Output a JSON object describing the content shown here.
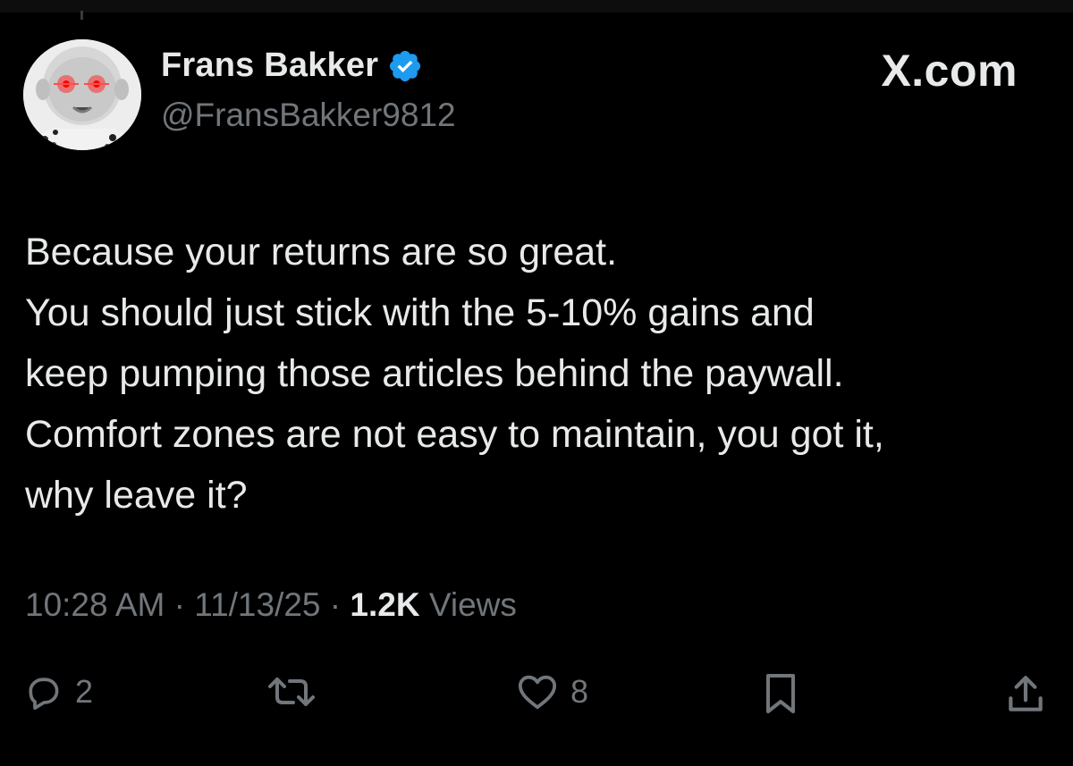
{
  "tweet": {
    "author": {
      "name": "Frans Bakker",
      "handle": "@FransBakker9812",
      "verified_icon": "verified-badge-icon"
    },
    "brand": "X.com",
    "text_lines": [
      "Because your returns are so great.",
      "You should just stick with the 5-10% gains and",
      "keep pumping those articles behind the paywall.",
      "Comfort zones are not easy to maintain, you got it,",
      "why leave it?"
    ],
    "meta": {
      "time": "10:28 AM",
      "separator": "·",
      "date": "11/13/25",
      "views_count": "1.2K",
      "views_label": "Views"
    },
    "actions": {
      "reply_count": "2",
      "like_count": "8"
    }
  },
  "colors": {
    "background": "#000000",
    "text_primary": "#e7e9ea",
    "text_secondary": "#71767b",
    "verified_blue": "#1d9bf0"
  }
}
